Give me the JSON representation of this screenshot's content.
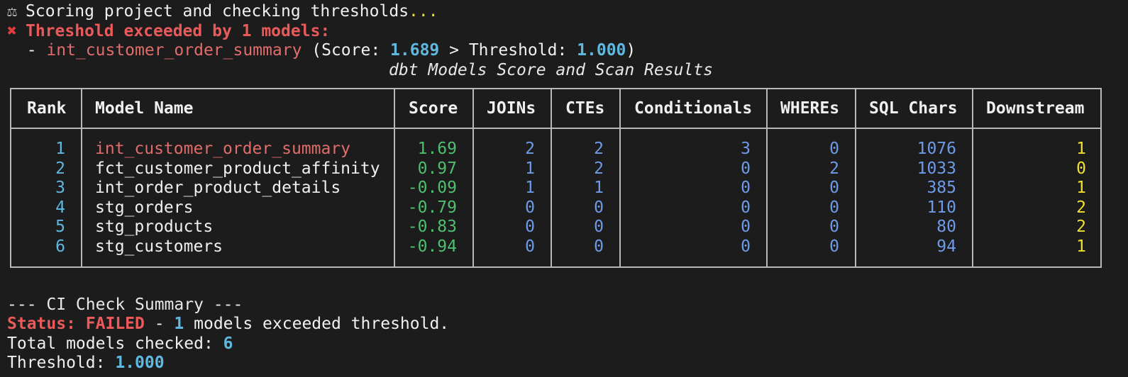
{
  "header": {
    "scoring_icon": "balance-scale-icon",
    "scoring_text": "Scoring project and checking thresholds",
    "scoring_ellipsis": "...",
    "error_icon": "cross-mark-icon",
    "error_text": "Threshold exceeded by 1 models:",
    "exceed_prefix": "  - ",
    "exceed_model": "int_customer_order_summary",
    "exceed_score_label": " (Score: ",
    "exceed_score": "1.689",
    "exceed_mid": " > Threshold: ",
    "exceed_threshold": "1.000",
    "exceed_close": ")"
  },
  "table": {
    "title": "dbt Models Score and Scan Results",
    "columns": [
      "Rank",
      "Model Name",
      "Score",
      "JOINs",
      "CTEs",
      "Conditionals",
      "WHEREs",
      "SQL Chars",
      "Downstream"
    ],
    "rows": [
      {
        "rank": "1",
        "model": "int_customer_order_summary",
        "score": "1.69",
        "joins": "2",
        "ctes": "2",
        "conditionals": "3",
        "wheres": "0",
        "sql_chars": "1076",
        "downstream": "1"
      },
      {
        "rank": "2",
        "model": "fct_customer_product_affinity",
        "score": "0.97",
        "joins": "1",
        "ctes": "2",
        "conditionals": "0",
        "wheres": "2",
        "sql_chars": "1033",
        "downstream": "0"
      },
      {
        "rank": "3",
        "model": "int_order_product_details",
        "score": "-0.09",
        "joins": "1",
        "ctes": "1",
        "conditionals": "0",
        "wheres": "0",
        "sql_chars": "385",
        "downstream": "1"
      },
      {
        "rank": "4",
        "model": "stg_orders",
        "score": "-0.79",
        "joins": "0",
        "ctes": "0",
        "conditionals": "0",
        "wheres": "0",
        "sql_chars": "110",
        "downstream": "2"
      },
      {
        "rank": "5",
        "model": "stg_products",
        "score": "-0.83",
        "joins": "0",
        "ctes": "0",
        "conditionals": "0",
        "wheres": "0",
        "sql_chars": "80",
        "downstream": "2"
      },
      {
        "rank": "6",
        "model": "stg_customers",
        "score": "-0.94",
        "joins": "0",
        "ctes": "0",
        "conditionals": "0",
        "wheres": "0",
        "sql_chars": "94",
        "downstream": "1"
      }
    ]
  },
  "summary": {
    "heading": "--- CI Check Summary ---",
    "status_label": "Status: ",
    "status_value": "FAILED",
    "status_dash": " - ",
    "status_count": "1",
    "status_rest": " models exceeded threshold.",
    "total_label": "Total models checked: ",
    "total_value": "6",
    "threshold_label": "Threshold: ",
    "threshold_value": "1.000"
  },
  "colors": {
    "background": "#1c1c1c",
    "error_red": "#ea5a5a",
    "model_red": "#e06c6c",
    "cyan": "#5fb8e0",
    "score_green": "#4fbf6f",
    "count_blue": "#6f9ae8",
    "downstream_yellow": "#f0e030"
  }
}
